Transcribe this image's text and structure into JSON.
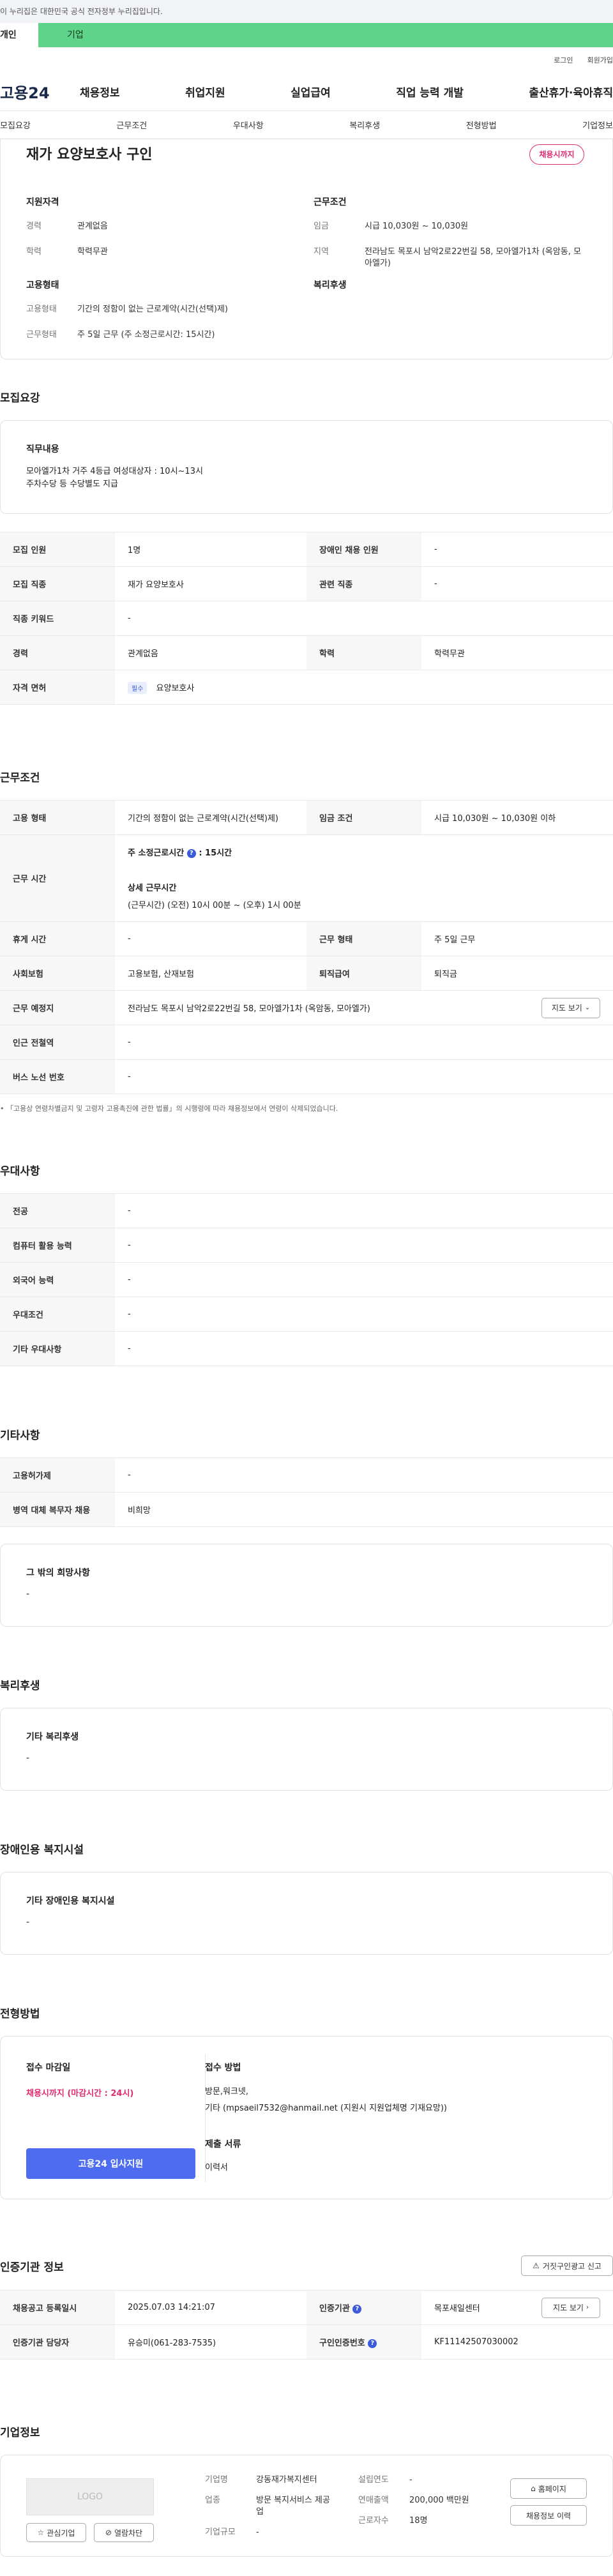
{
  "topbar": {
    "notice": "이 누리집은 대한민국 공식 전자정부 누리집입니다."
  },
  "usertabs": {
    "personal": "개인",
    "company": "기업"
  },
  "util": {
    "login": "로그인",
    "signup": "회원가입"
  },
  "gnb": {
    "logo": "고용24",
    "menu": [
      "채용정보",
      "취업지원",
      "실업급여",
      "직업 능력 개발",
      "출산휴가·육아휴직"
    ]
  },
  "subnav": [
    "모집요강",
    "근무조건",
    "우대사항",
    "복리후생",
    "전형방법",
    "기업정보"
  ],
  "summary": {
    "title": "재가 요양보호사 구인",
    "deadline_badge": "채용시까지",
    "qualification": {
      "heading": "지원자격",
      "career_k": "경력",
      "career_v": "관계없음",
      "edu_k": "학력",
      "edu_v": "학력무관"
    },
    "work": {
      "heading": "근무조건",
      "wage_k": "임금",
      "wage_v": "시급 10,030원 ~ 10,030원",
      "region_k": "지역",
      "region_v": "전라남도 목포시 남악2로22번길 58, 모아엘가1차 (옥암동, 모아엘가)"
    },
    "employment": {
      "heading": "고용형태",
      "type_k": "고용형태",
      "type_v": "기간의 정함이 없는 근로계약(시간(선택)제)",
      "hours_k": "근무형태",
      "hours_v": "주 5일 근무 (주 소정근로시간: 15시간)"
    },
    "welfare": {
      "heading": "복리후생"
    }
  },
  "recruit": {
    "title": "모집요강",
    "duty_heading": "직무내용",
    "duty_line1": "모아엘가1차 거주 4등급 여성대상자 : 10시~13시",
    "duty_line2": "주차수당 등 수당별도 지급",
    "rows": {
      "count_k": "모집 인원",
      "count_v": "1명",
      "disabled_k": "장애인 채용 인원",
      "disabled_v": "-",
      "job_k": "모집 직종",
      "job_v": "재가 요양보호사",
      "related_k": "관련 직종",
      "related_v": "-",
      "keyword_k": "직종 키워드",
      "keyword_v": "-",
      "career_k": "경력",
      "career_v": "관계없음",
      "edu_k": "학력",
      "edu_v": "학력무관",
      "license_k": "자격 면허",
      "license_tag": "필수",
      "license_v": "요양보호사"
    }
  },
  "conditions": {
    "title": "근무조건",
    "type_k": "고용 형태",
    "type_v": "기간의 정함이 없는 근로계약(시간(선택)제)",
    "wage_k": "임금 조건",
    "wage_v": "시급 10,030원 ~ 10,030원 이하",
    "time_k": "근무 시간",
    "time_weekly_label": "주 소정근로시간",
    "time_weekly_value": "15시간",
    "time_detail_label": "상세 근무시간",
    "time_detail_value": "(근무시간) (오전) 10시 00분 ~ (오후) 1시 00분",
    "rest_k": "휴게 시간",
    "rest_v": "-",
    "shape_k": "근무 형태",
    "shape_v": "주 5일 근무",
    "insurance_k": "사회보험",
    "insurance_v": "고용보험, 산재보험",
    "retire_k": "퇴직급여",
    "retire_v": "퇴직금",
    "place_k": "근무 예정지",
    "place_v": "전라남도 목포시 남악2로22번길 58, 모아엘가1차 (옥암동, 모아엘가)",
    "map_btn": "지도 보기",
    "subway_k": "인근 전철역",
    "subway_v": "-",
    "bus_k": "버스 노선 번호",
    "bus_v": "-",
    "note": "「고용상 연령차별금지 및 고령자 고용촉진에 관한 법률」의 시행령에 따라 채용정보에서 연령이 삭제되었습니다."
  },
  "prefer": {
    "title": "우대사항",
    "rows": [
      {
        "k": "전공",
        "v": "-"
      },
      {
        "k": "컴퓨터 활용 능력",
        "v": "-"
      },
      {
        "k": "외국어 능력",
        "v": "-"
      },
      {
        "k": "우대조건",
        "v": "-"
      },
      {
        "k": "기타 우대사항",
        "v": "-"
      }
    ]
  },
  "etc": {
    "title": "기타사항",
    "rows": [
      {
        "k": "고용허가제",
        "v": "-"
      },
      {
        "k": "병역 대체 복무자 채용",
        "v": "비희망"
      }
    ],
    "other_heading": "그 밖의 희망사항",
    "other_v": "-"
  },
  "welfare": {
    "title": "복리후생",
    "heading": "기타 복리후생",
    "value": "-"
  },
  "disabled": {
    "title": "장애인용 복지시설",
    "heading": "기타 장애인용 복지시설",
    "value": "-"
  },
  "selection": {
    "title": "전형방법",
    "deadline_heading": "접수 마감일",
    "deadline_value": "채용시까지 (마감시간 : 24시)",
    "apply_btn": "고용24 입사지원",
    "method_heading": "접수 방법",
    "method_line1": "방문,워크넷,",
    "method_line2": "기타 (mpsaeil7532@hanmail.net (지원시 지원업체명 기재요망))",
    "docs_heading": "제출 서류",
    "docs_value": "이력서"
  },
  "cert": {
    "title": "인증기관 정보",
    "report_btn": "거짓구인광고 신고",
    "reg_k": "채용공고 등록일시",
    "reg_v": "2025.07.03 14:21:07",
    "org_k": "인증기관",
    "org_v": "목포새일센터",
    "map_btn": "지도 보기",
    "manager_k": "인증기관 담당자",
    "manager_v": "유승미(061-283-7535)",
    "num_k": "구인인증번호",
    "num_v": "KF11142507030002"
  },
  "company": {
    "title": "기업정보",
    "logo": "LOGO",
    "fav_btn": "관심기업",
    "view_btn": "열람차단",
    "name_k": "기업명",
    "name_v": "강동재가복지센터",
    "industry_k": "업종",
    "industry_v": "방문 복지서비스 제공업",
    "size_k": "기업규모",
    "size_v": "-",
    "founded_k": "설립연도",
    "founded_v": "-",
    "sales_k": "연매출액",
    "sales_v": "200,000 백만원",
    "staff_k": "근로자수",
    "staff_v": "18명",
    "home_btn": "홈페이지",
    "jobs_btn": "채용정보 이력"
  }
}
